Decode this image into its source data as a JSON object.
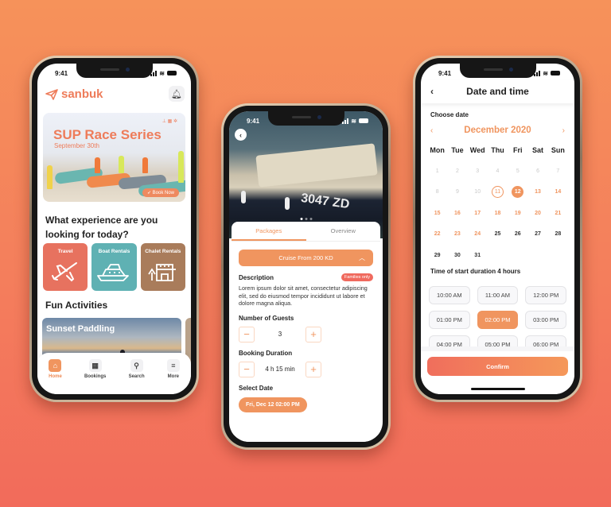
{
  "colors": {
    "accent": "#f0955f",
    "brand": "#ee7c5a",
    "travel": "#e7725f",
    "boat": "#5fb1b3",
    "chalet": "#a97c5b",
    "badge": "#f06a5e"
  },
  "status": {
    "time": "9:41"
  },
  "home": {
    "brand": "sanbuk",
    "hero": {
      "title": "SUP Race Series",
      "subtitle": "September 30th",
      "cta": "Book Now"
    },
    "question": "What experience are you looking for today?",
    "categories": [
      {
        "label": "Travel",
        "icon": "airplane-icon"
      },
      {
        "label": "Boat Rentals",
        "icon": "yacht-icon"
      },
      {
        "label": "Chalet Rentals",
        "icon": "chalet-icon"
      }
    ],
    "fun_title": "Fun Activities",
    "activities": [
      {
        "title": "Sunset Paddling"
      }
    ],
    "tabbar": [
      {
        "label": "Home",
        "icon": "home-icon",
        "active": true
      },
      {
        "label": "Bookings",
        "icon": "calendar-icon"
      },
      {
        "label": "Search",
        "icon": "search-icon"
      },
      {
        "label": "More",
        "icon": "menu-icon"
      }
    ]
  },
  "detail": {
    "boat_number": "3047 ZD",
    "tabs": [
      "Packages",
      "Overview"
    ],
    "package": "Cruise From 200 KD",
    "description_title": "Description",
    "badge": "Families only",
    "description": "Lorem ipsum dolor sit amet, consectetur adipiscing elit, sed do eiusmod tempor incididunt ut labore et dolore magna aliqua.",
    "guests_title": "Number of Guests",
    "guests": "3",
    "duration_title": "Booking Duration",
    "duration": "4 h 15 min",
    "date_title": "Select Date",
    "date": "Fri, Dec 12 02:00 PM"
  },
  "datetime": {
    "title": "Date and time",
    "choose_date": "Choose date",
    "month": "December 2020",
    "weekdays": [
      "Mon",
      "Tue",
      "Wed",
      "Thu",
      "Fri",
      "Sat",
      "Sun"
    ],
    "today": 11,
    "selected": 12,
    "available_through": 24,
    "days_in_month": 31,
    "time_label": "Time of start duration 4 hours",
    "times": [
      "10:00 AM",
      "11:00 AM",
      "12:00 PM",
      "01:00 PM",
      "02:00 PM",
      "03:00 PM",
      "04:00 PM",
      "05:00 PM",
      "06:00 PM"
    ],
    "selected_time": "02:00 PM",
    "confirm": "Confirm"
  }
}
